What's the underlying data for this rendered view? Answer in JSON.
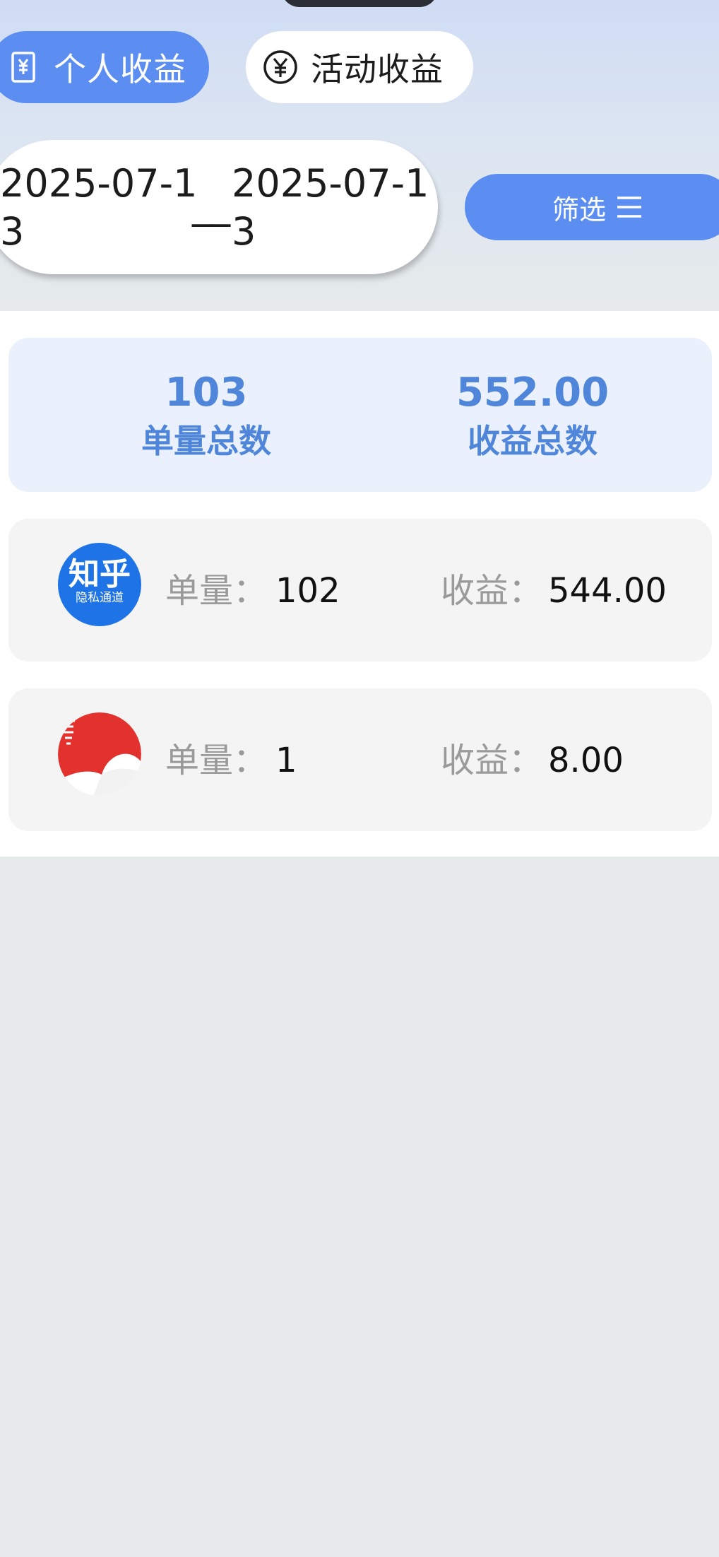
{
  "tabs": {
    "personal": "个人收益",
    "activity": "活动收益"
  },
  "date_range": {
    "start": "2025-07-13",
    "separator": "__",
    "end": "2025-07-13"
  },
  "filter": {
    "label": "筛选"
  },
  "summary": {
    "total_orders_value": "103",
    "total_orders_label": "单量总数",
    "total_earnings_value": "552.00",
    "total_earnings_label": "收益总数"
  },
  "platforms": [
    {
      "logo_main": "知乎",
      "logo_sub": "隐私通道",
      "orders_label": "单量：",
      "orders_value": "102",
      "earnings_label": "收益：",
      "earnings_value": "544.00"
    },
    {
      "orders_label": "单量：",
      "orders_value": "1",
      "earnings_label": "收益：",
      "earnings_value": "8.00"
    }
  ],
  "colors": {
    "accent": "#5b8ef0",
    "summary_text": "#4f86d9",
    "summary_bg": "#eaf1fd",
    "page_bg": "#e6eaea"
  },
  "icons": {
    "personal_tab": "receipt-yen-icon",
    "activity_tab": "yen-circle-icon",
    "filter": "menu-lines-icon"
  }
}
